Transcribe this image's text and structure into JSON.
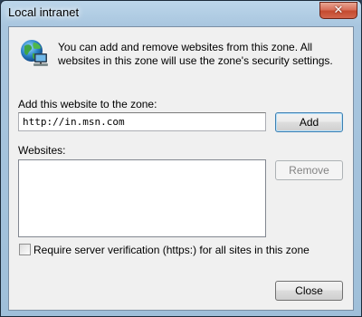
{
  "window": {
    "title": "Local intranet",
    "close_glyph": "✕"
  },
  "info": {
    "icon": "intranet-globe-icon",
    "text": "You can add and remove websites from this zone. All websites in this zone will use the zone's security settings."
  },
  "add_section": {
    "label": "Add this website to the zone:",
    "url_value": "http://in.msn.com",
    "add_button": "Add"
  },
  "websites_section": {
    "label": "Websites:",
    "items": [],
    "remove_button": "Remove",
    "remove_enabled": false
  },
  "options": {
    "require_https_label": "Require server verification (https:) for all sites in this zone",
    "require_https_checked": false
  },
  "footer": {
    "close_button": "Close"
  },
  "colors": {
    "default_button_border": "#3c7fb1",
    "dialog_background": "#f0f0f0",
    "titlebar": "#a9c6df",
    "close_button": "#c44a2f"
  }
}
